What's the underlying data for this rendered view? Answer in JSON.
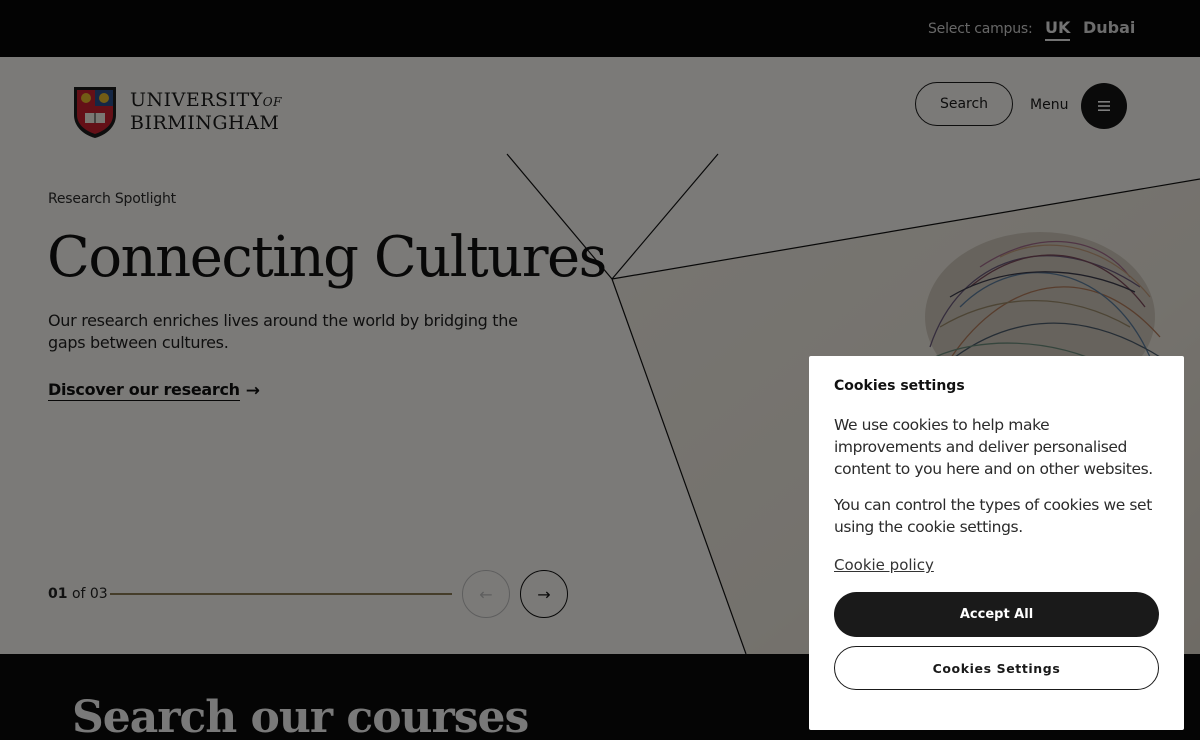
{
  "campus": {
    "label": "Select campus:",
    "options": [
      "UK",
      "Dubai"
    ],
    "selected": "UK"
  },
  "header": {
    "logo_line1": "UNIVERSITY",
    "logo_of": "OF",
    "logo_line2": "BIRMINGHAM",
    "search_label": "Search",
    "menu_label": "Menu",
    "menu_icon": "hamburger-icon"
  },
  "hero": {
    "eyebrow": "Research Spotlight",
    "title": "Connecting Cultures",
    "description": "Our research enriches lives around the world by bridging the gaps between cultures.",
    "cta_label": "Discover our research",
    "cta_icon": "arrow-right-icon",
    "slide_current": "01",
    "slide_of": "of",
    "slide_total": "03",
    "progress": 1.0,
    "prev_icon": "arrow-left-icon",
    "next_icon": "arrow-right-icon"
  },
  "courses": {
    "title": "Search our courses"
  },
  "cookie_dialog": {
    "title": "Cookies settings",
    "paragraph1": "We use cookies to help make improvements and deliver personalised content to you here and on other websites.",
    "paragraph2": "You can control the types of cookies we set using the cookie settings.",
    "policy_link": "Cookie policy",
    "accept_label": "Accept All",
    "settings_label": "Cookies Settings"
  },
  "colors": {
    "top_bar": "#060606",
    "hero_bg": "#f7f5f1",
    "accent_gold": "#b8a98a",
    "button_dark": "#1a1a1a"
  }
}
